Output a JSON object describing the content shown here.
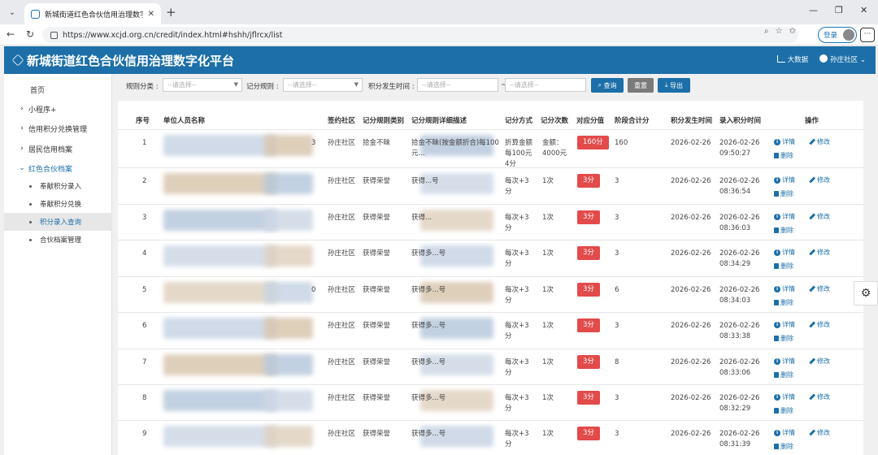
{
  "browser": {
    "tab_title": "新城街道红色合伙信用治理数字化平",
    "url": "https://www.xcjd.org.cn/credit/index.html#hshh/jflrcx/list",
    "login_label": "登录"
  },
  "app": {
    "title": "新城街道红色合伙信用治理数字化平台",
    "bigdata_label": "大数据",
    "user_label": "孙庄社区"
  },
  "sidebar": {
    "items": [
      {
        "label": "首页"
      },
      {
        "label": "小程序+"
      },
      {
        "label": "信用积分兑换管理"
      },
      {
        "label": "居民信用档案"
      },
      {
        "label": "红色合伙档案"
      },
      {
        "label": "奉献积分录入"
      },
      {
        "label": "奉献积分兑换"
      },
      {
        "label": "积分录入查询"
      },
      {
        "label": "合伙档案管理"
      }
    ]
  },
  "filter": {
    "rule_type_label": "规则分类 :",
    "rule_type_placeholder": "--请选择--",
    "rule_label": "记分规则 :",
    "rule_placeholder": "--请选择--",
    "time_label": "积分发生时间 :",
    "start_placeholder": "--请选择--",
    "separator": "~",
    "end_placeholder": "--请选择--",
    "search_btn": "查询",
    "reset_btn": "重置",
    "export_btn": "导出"
  },
  "table": {
    "headers": [
      "序号",
      "单位人员名称",
      "签约社区",
      "记分规则类别",
      "记分规则详细描述",
      "记分方式",
      "记分次数",
      "对应分值",
      "阶段合计分",
      "积分发生时间",
      "录入积分时间",
      "操作"
    ],
    "detail_label": "详情",
    "delete_label": "删除",
    "edit_label": "修改",
    "rows": [
      {
        "no": "1",
        "name_frag": "3",
        "community": "孙庄社区",
        "category": "拾金不昧",
        "desc": "拾金不昧(按金额折合)每100元...",
        "method": "折算金额每100元4分",
        "count": "金额：4000元",
        "score": "160分",
        "total": "160",
        "date": "2026-02-26",
        "entered": "2026-02-26 09:50:27"
      },
      {
        "no": "2",
        "name_frag": "",
        "community": "孙庄社区",
        "category": "获得荣誉",
        "desc": "获得...号",
        "method": "每次+3分",
        "count": "1次",
        "score": "3分",
        "total": "3",
        "date": "2026-02-26",
        "entered": "2026-02-26 08:36:54"
      },
      {
        "no": "3",
        "name_frag": "",
        "community": "孙庄社区",
        "category": "获得荣誉",
        "desc": "获得...",
        "method": "每次+3分",
        "count": "1次",
        "score": "3分",
        "total": "3",
        "date": "2026-02-26",
        "entered": "2026-02-26 08:36:03"
      },
      {
        "no": "4",
        "name_frag": "",
        "community": "孙庄社区",
        "category": "获得荣誉",
        "desc": "获得多...号",
        "method": "每次+3分",
        "count": "1次",
        "score": "3分",
        "total": "3",
        "date": "2026-02-26",
        "entered": "2026-02-26 08:34:29"
      },
      {
        "no": "5",
        "name_frag": "0",
        "community": "孙庄社区",
        "category": "获得荣誉",
        "desc": "获得多...号",
        "method": "每次+3分",
        "count": "1次",
        "score": "3分",
        "total": "6",
        "date": "2026-02-26",
        "entered": "2026-02-26 08:34:03"
      },
      {
        "no": "6",
        "name_frag": "",
        "community": "孙庄社区",
        "category": "获得荣誉",
        "desc": "获得多...号",
        "method": "每次+3分",
        "count": "1次",
        "score": "3分",
        "total": "3",
        "date": "2026-02-26",
        "entered": "2026-02-26 08:33:38"
      },
      {
        "no": "7",
        "name_frag": "",
        "community": "孙庄社区",
        "category": "获得荣誉",
        "desc": "获得多...号",
        "method": "每次+3分",
        "count": "1次",
        "score": "3分",
        "total": "8",
        "date": "2026-02-26",
        "entered": "2026-02-26 08:33:06"
      },
      {
        "no": "8",
        "name_frag": "",
        "community": "孙庄社区",
        "category": "获得荣誉",
        "desc": "获得多...号",
        "method": "每次+3分",
        "count": "1次",
        "score": "3分",
        "total": "3",
        "date": "2026-02-26",
        "entered": "2026-02-26 08:32:29"
      },
      {
        "no": "9",
        "name_frag": "",
        "community": "孙庄社区",
        "category": "获得荣誉",
        "desc": "获得多...号",
        "method": "每次+3分",
        "count": "1次",
        "score": "3分",
        "total": "3",
        "date": "2026-02-26",
        "entered": "2026-02-26 08:31:39"
      }
    ]
  }
}
